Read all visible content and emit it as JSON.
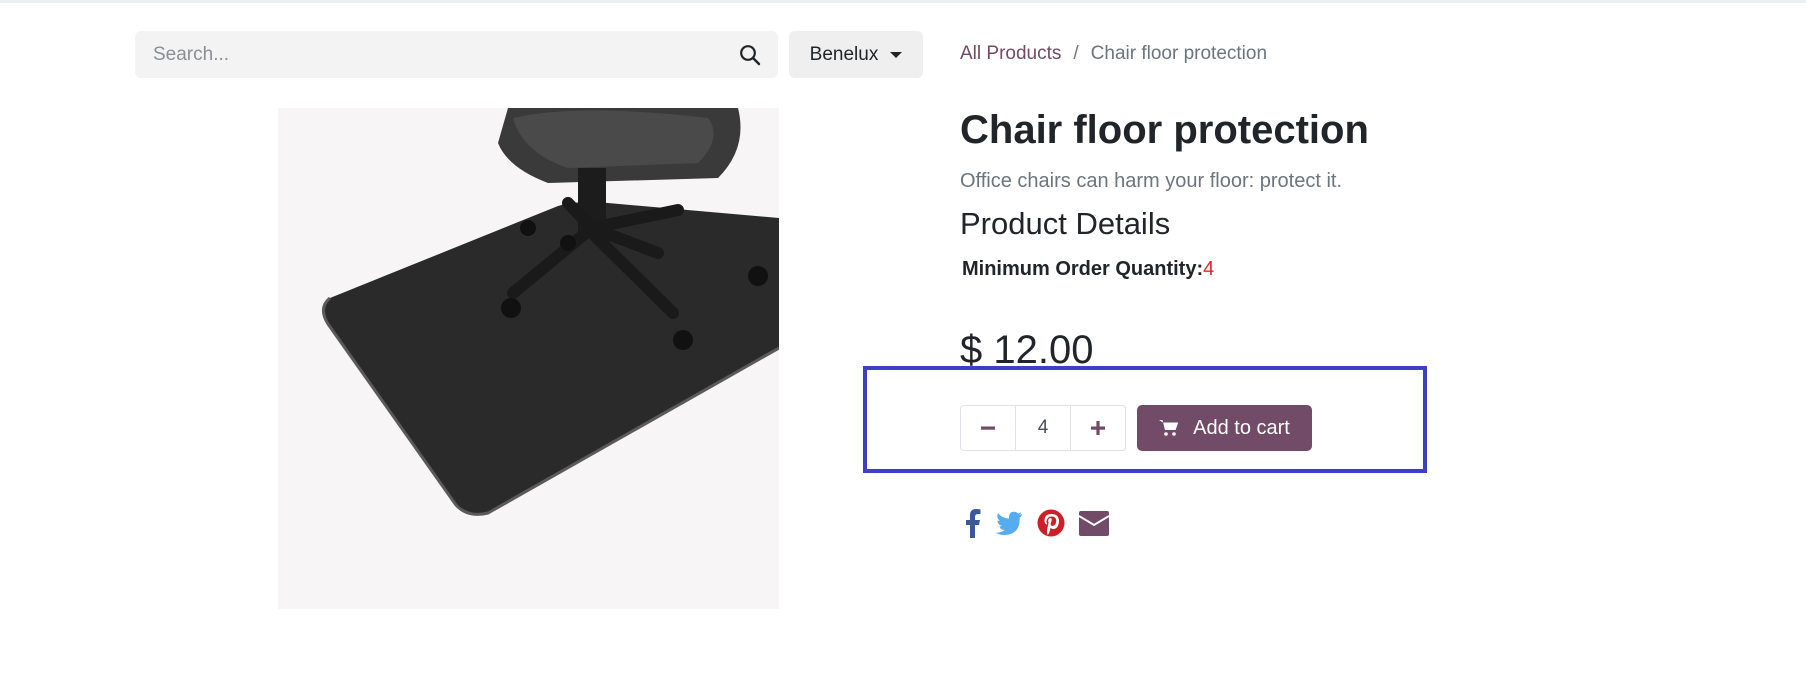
{
  "search": {
    "placeholder": "Search..."
  },
  "pricelist": {
    "label": "Benelux"
  },
  "breadcrumb": {
    "parent": "All Products",
    "separator": "/",
    "current": "Chair floor protection"
  },
  "product": {
    "name": "Chair floor protection",
    "description": "Office chairs can harm your floor: protect it.",
    "details_heading": "Product Details",
    "min_qty_label": "Minimum Order Quantity:",
    "min_qty_value": "4",
    "price": "$ 12.00",
    "quantity": "4",
    "add_to_cart_label": "Add to cart"
  },
  "share_icons": [
    "facebook-icon",
    "twitter-icon",
    "pinterest-icon",
    "email-icon"
  ],
  "colors": {
    "brand": "#714b67",
    "highlight": "#3d3fc6",
    "facebook": "#3b5998",
    "twitter": "#55acee",
    "pinterest": "#cb2027",
    "required_value": "#e3242b"
  }
}
